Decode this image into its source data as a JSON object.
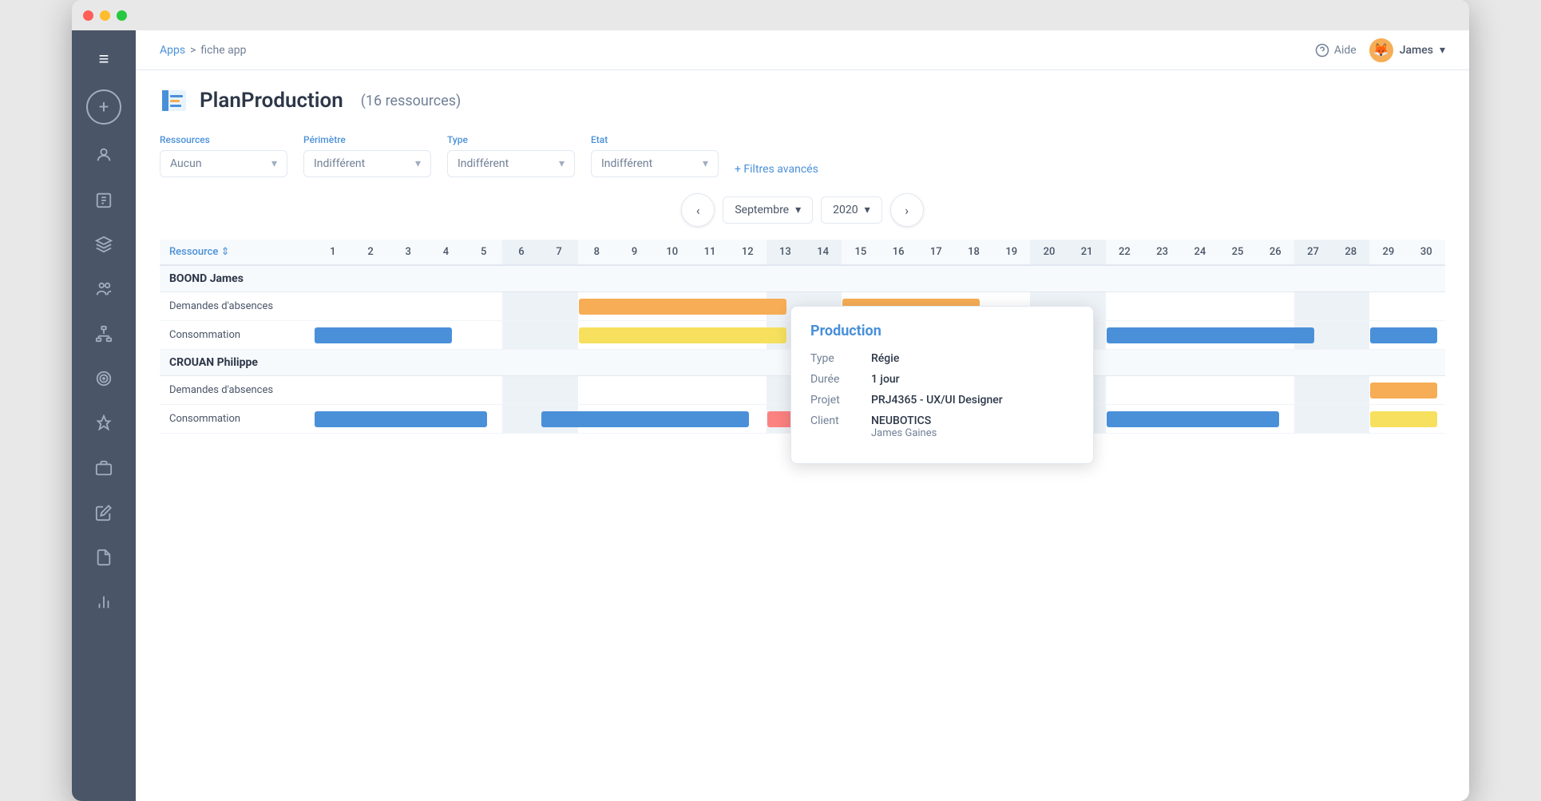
{
  "window": {
    "title": "PlanProduction"
  },
  "breadcrumb": {
    "root": "Apps",
    "separator": ">",
    "current": "fiche app"
  },
  "topbar": {
    "help_label": "Aide",
    "user_name": "James",
    "chevron": "▾"
  },
  "page": {
    "title": "PlanProduction",
    "subtitle": "(16 ressources)"
  },
  "filters": {
    "ressources_label": "Ressources",
    "ressources_value": "Aucun",
    "perimetre_label": "Périmètre",
    "perimetre_value": "Indifférent",
    "type_label": "Type",
    "type_value": "Indifférent",
    "etat_label": "Etat",
    "etat_value": "Indifférent",
    "advanced": "+ Filtres avancés"
  },
  "calendar": {
    "prev": "‹",
    "next": "›",
    "month": "Septembre",
    "month_chevron": "▾",
    "year": "2020",
    "year_chevron": "▾"
  },
  "gantt": {
    "resource_header": "Ressource ⇕",
    "days": [
      1,
      2,
      3,
      4,
      5,
      6,
      7,
      8,
      9,
      10,
      11,
      12,
      13,
      14,
      15,
      16,
      17,
      18,
      19,
      20,
      21,
      22,
      23,
      24,
      25,
      26,
      27,
      28,
      29,
      30
    ],
    "weekend_days": [
      6,
      7,
      13,
      14,
      20,
      21,
      27,
      28
    ]
  },
  "persons": [
    {
      "name": "BOOND James",
      "rows": [
        {
          "label": "Demandes d'absences"
        },
        {
          "label": "Consommation"
        }
      ]
    },
    {
      "name": "CROUAN Philippe",
      "rows": [
        {
          "label": "Demandes d'absences"
        },
        {
          "label": "Consommation"
        }
      ]
    }
  ],
  "popup": {
    "title": "Production",
    "type_label": "Type",
    "type_value": "Régie",
    "duree_label": "Durée",
    "duree_value": "1 jour",
    "projet_label": "Projet",
    "projet_value": "PRJ4365 - UX/UI Designer",
    "client_label": "Client",
    "client_value": "NEUBOTICS",
    "client_sub": "James Gaines"
  },
  "sidebar": {
    "menu_icon": "≡",
    "add_icon": "+",
    "items": [
      {
        "icon": "👤",
        "name": "profile"
      },
      {
        "icon": "📋",
        "name": "tasks"
      },
      {
        "icon": "🎓",
        "name": "education"
      },
      {
        "icon": "👥",
        "name": "team"
      },
      {
        "icon": "🏢",
        "name": "org"
      },
      {
        "icon": "🎯",
        "name": "target"
      },
      {
        "icon": "📌",
        "name": "pin"
      },
      {
        "icon": "💼",
        "name": "briefcase"
      },
      {
        "icon": "✏️",
        "name": "edit"
      },
      {
        "icon": "📄",
        "name": "document"
      },
      {
        "icon": "📊",
        "name": "chart"
      }
    ]
  },
  "colors": {
    "blue": "#4a90d9",
    "orange": "#f6ad55",
    "yellow": "#f6e05e",
    "red": "#fc8181",
    "sidebar_bg": "#4a5568"
  }
}
